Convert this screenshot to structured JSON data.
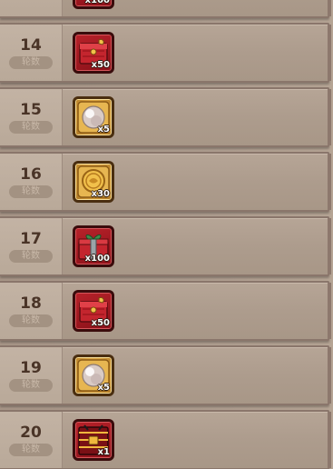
{
  "round_label": "轮数",
  "rows": [
    {
      "round": "",
      "item": "red-chest",
      "qty": "x100"
    },
    {
      "round": "14",
      "item": "red-chest",
      "qty": "x50"
    },
    {
      "round": "15",
      "item": "pearl",
      "qty": "x5"
    },
    {
      "round": "16",
      "item": "gold-coin",
      "qty": "x30"
    },
    {
      "round": "17",
      "item": "gift-box",
      "qty": "x100"
    },
    {
      "round": "18",
      "item": "red-chest",
      "qty": "x50"
    },
    {
      "round": "19",
      "item": "pearl",
      "qty": "x5"
    },
    {
      "round": "20",
      "item": "treasure-chest",
      "qty": "x1"
    }
  ],
  "colors": {
    "panel": "#ad9c8e",
    "round_text": "#4a3427",
    "label_pill": "#a39282",
    "red_frame": "#b8222a",
    "gold_frame": "#d9a23f"
  }
}
